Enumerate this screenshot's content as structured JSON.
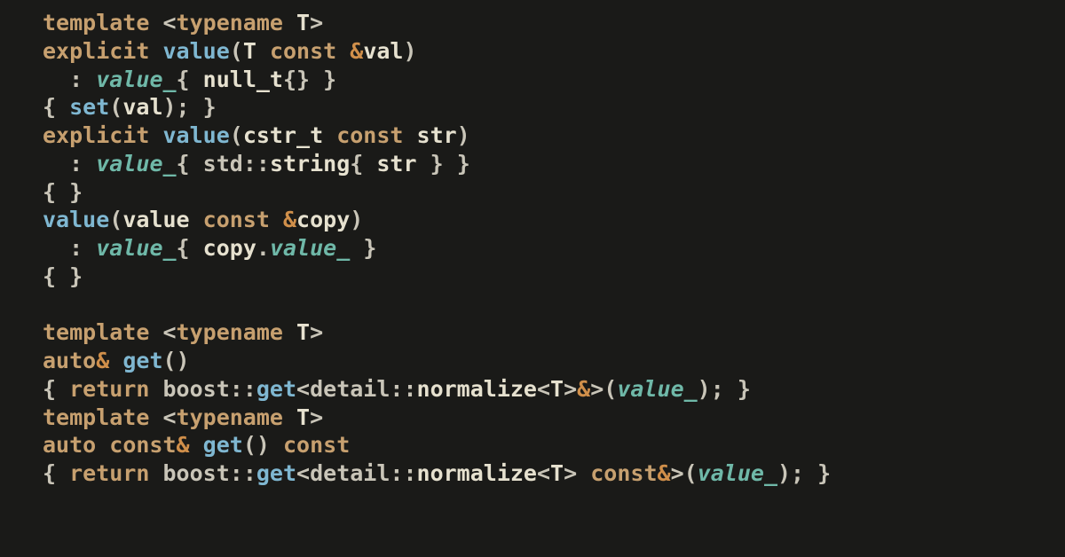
{
  "tokens": {
    "template": "template",
    "typename": "typename",
    "T": "T",
    "explicit": "explicit",
    "value_fn": "value",
    "value_ty": "value",
    "const": "const",
    "amp": "&",
    "val": "val",
    "value_mem": "value_",
    "null_t": "null_t",
    "set": "set",
    "cstr_t": "cstr_t",
    "str": "str",
    "std": "std",
    "string": "string",
    "copy": "copy",
    "auto": "auto",
    "get": "get",
    "return": "return",
    "boost": "boost",
    "detail": "detail",
    "normalize": "normalize"
  },
  "chart_data": null
}
